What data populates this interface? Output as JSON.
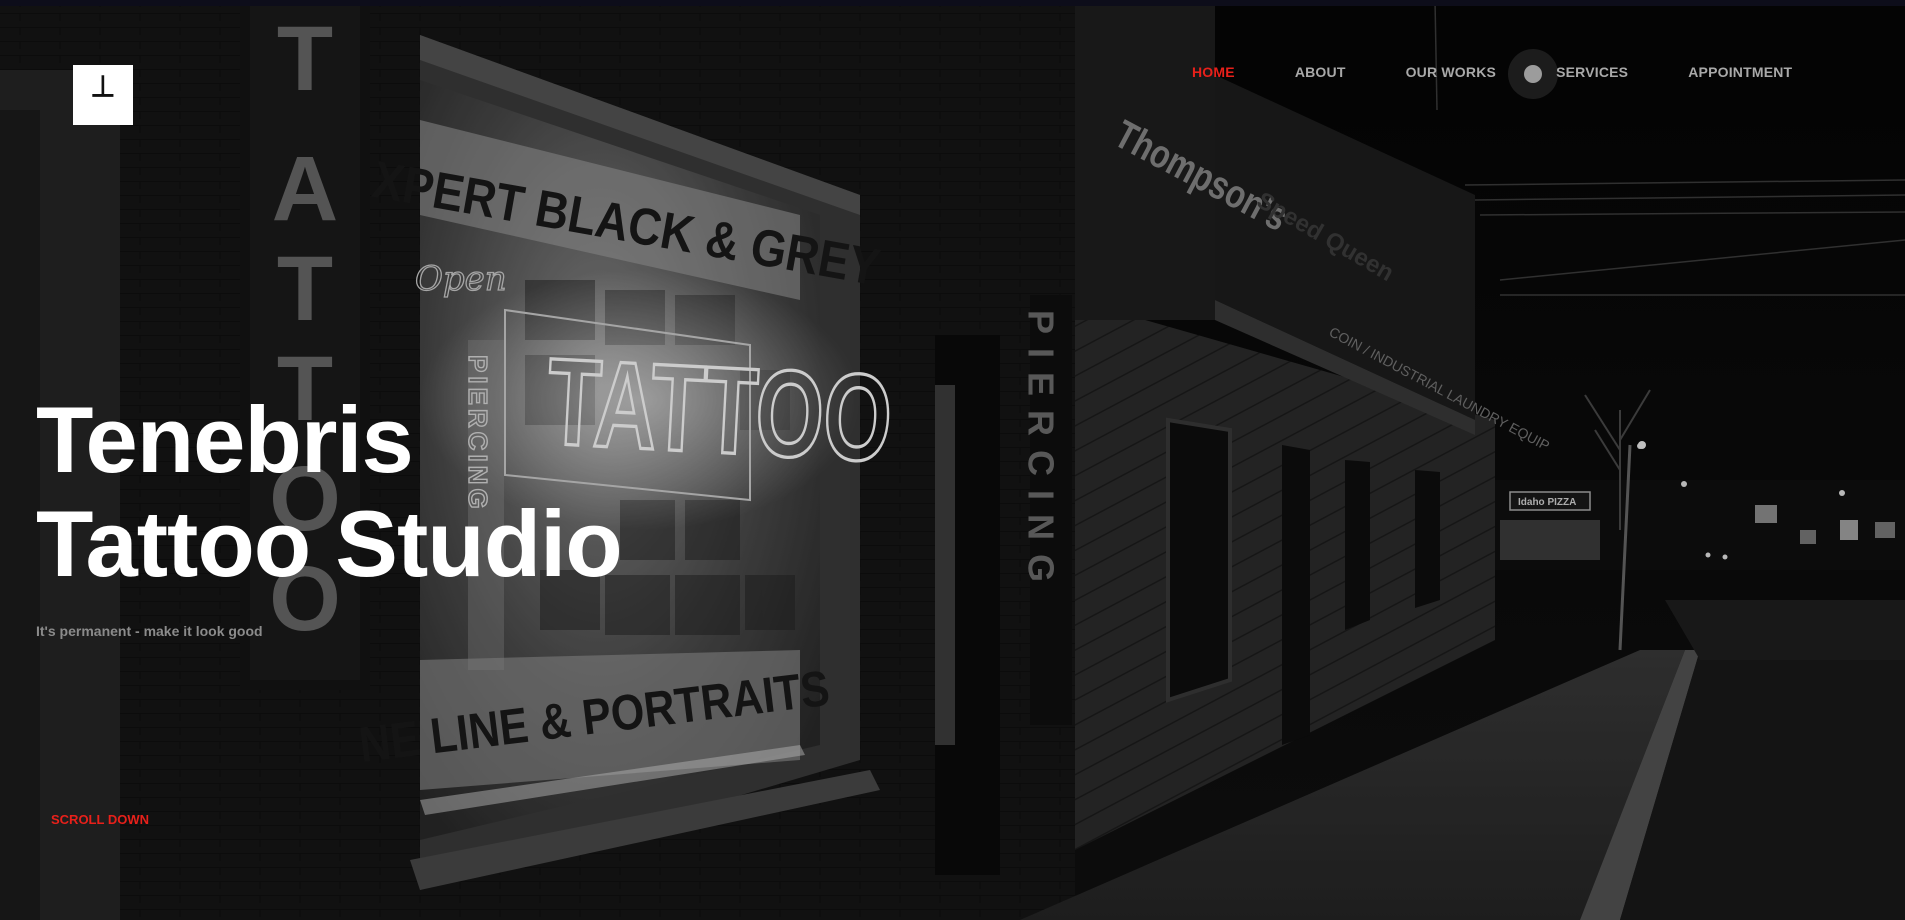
{
  "brand": {
    "logo_mark": "┴",
    "logo_icon": "studio-logo-icon"
  },
  "nav": {
    "items": [
      {
        "label": "HOME",
        "active": true
      },
      {
        "label": "ABOUT",
        "active": false
      },
      {
        "label": "OUR WORKS",
        "active": false
      },
      {
        "label": "SERVICES",
        "active": false
      },
      {
        "label": "APPOINTMENT",
        "active": false
      }
    ]
  },
  "hero": {
    "title_line1": "Tenebris",
    "title_line2": "Tattoo Studio",
    "tagline": "It's permanent - make it look good",
    "scroll_label": "SCROLL DOWN"
  },
  "photo": {
    "window_sign_top": "XPERT BLACK & GREY",
    "window_sign_bottom": "NE LINE & PORTRAITS",
    "neon_sign": "TATTOO",
    "vertical_sign_left": "TATTOO",
    "vertical_sign_piercing": "PIERCING",
    "vertical_neon_piercing": "PIERCING",
    "awning_text": "Thompson's",
    "awning_subtext": "COIN / INDUSTRIAL LAUNDRY EQUIP",
    "awning_side_text": "Speed Queen",
    "distant_sign": "Idaho PIZZA",
    "window_script": "Open"
  },
  "colors": {
    "accent": "#e8201a",
    "nav_text": "#a9a9a9",
    "title_text": "#ffffff",
    "tagline_text": "#8b8b8b",
    "logo_bg": "#ffffff"
  }
}
